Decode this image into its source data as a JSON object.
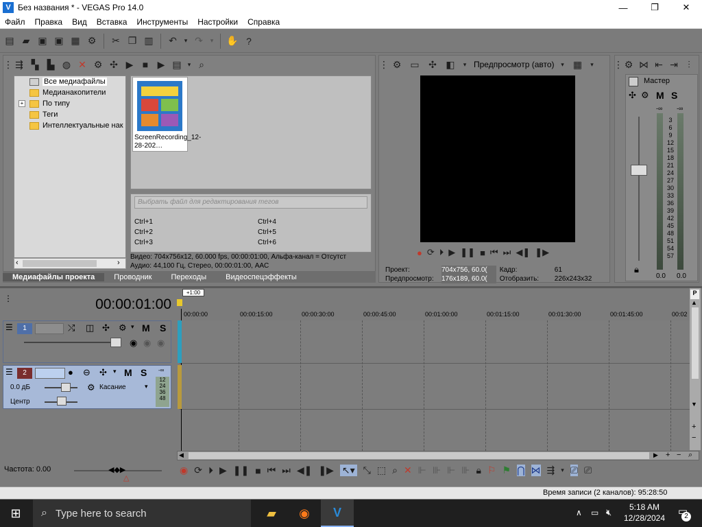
{
  "window": {
    "title": "Без названия * - VEGAS Pro 14.0",
    "logo": "V",
    "min": "—",
    "max": "❐",
    "close": "✕"
  },
  "menu": [
    "Файл",
    "Правка",
    "Вид",
    "Вставка",
    "Инструменты",
    "Настройки",
    "Справка"
  ],
  "media": {
    "tree": [
      "Все медиафайлы",
      "Медианакопители",
      "По типу",
      "Теги",
      "Интеллектуальные нак"
    ],
    "thumb_caption": "ScreenRecording_12-28-202…",
    "filter_placeholder": "Выбрать файл для редактирования тегов",
    "shortcuts": [
      "Ctrl+1",
      "Ctrl+2",
      "Ctrl+3",
      "Ctrl+4",
      "Ctrl+5",
      "Ctrl+6"
    ],
    "video_info": "Видео: 704x756x12, 60.000 fps, 00:00:01:00, Альфа-канал = Отсутст",
    "audio_info": "Аудио: 44,100 Гц, Стерео, 00:00:01:00, AAC",
    "tabs": [
      "Медиафайлы проекта",
      "Проводник",
      "Переходы",
      "Видеоспецэффекты"
    ]
  },
  "preview": {
    "mode": "Предпросмотр (авто)",
    "project_label": "Проект:",
    "project_val": "704x756, 60.0(",
    "preview_label": "Предпросмотр:",
    "preview_val": "176x189, 60.0(",
    "frame_label": "Кадр:",
    "frame_val": "61",
    "display_label": "Отобразить:",
    "display_val": "226x243x32"
  },
  "master": {
    "title": "Мастер",
    "m": "M",
    "s": "S",
    "inf": "-∞",
    "scale": [
      "3",
      "6",
      "9",
      "12",
      "15",
      "18",
      "21",
      "24",
      "27",
      "30",
      "33",
      "36",
      "39",
      "42",
      "45",
      "48",
      "51",
      "54",
      "57"
    ],
    "left_val": "0.0",
    "right_val": "0.0"
  },
  "timeline": {
    "timecode": "00:00:01:00",
    "marker": "+1:00",
    "ruler": [
      "00:00:00",
      "00:00:15:00",
      "00:00:30:00",
      "00:00:45:00",
      "00:01:00:00",
      "00:01:15:00",
      "00:01:30:00",
      "00:01:45:00",
      "00:02"
    ],
    "track1": {
      "num": "1",
      "m": "M",
      "s": "S"
    },
    "track2": {
      "num": "2",
      "m": "M",
      "s": "S",
      "vol": "0.0 дБ",
      "pan": "Центр",
      "touch": "Касание",
      "meter": [
        "-∞",
        "12",
        "24",
        "36",
        "48"
      ]
    },
    "rate": "Частота: 0.00"
  },
  "status": "Время записи (2 каналов): 95:28:50",
  "taskbar": {
    "search": "Type here to search",
    "time": "5:18 AM",
    "date": "12/28/2024",
    "notif": "2"
  }
}
